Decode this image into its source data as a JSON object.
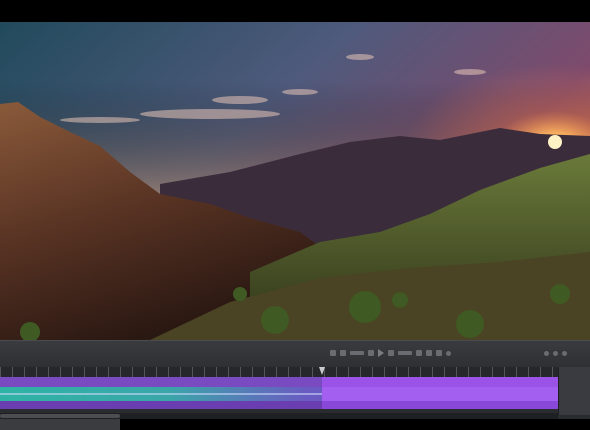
{
  "viewer": {
    "content": "sunset-mountain-landscape"
  },
  "colors": {
    "sky_top": "#2c4a5a",
    "sky_horizon": "#d9a060",
    "sun": "#ffd27a",
    "clip_purple": "#9b52e6",
    "clip_teal": "#2fb3a5",
    "panel": "#2a2b2e"
  },
  "timeline": {
    "tracks": [
      "video-2",
      "video-1",
      "audio-1"
    ]
  },
  "icons": {
    "play": "play-icon",
    "step": "step-icon"
  }
}
